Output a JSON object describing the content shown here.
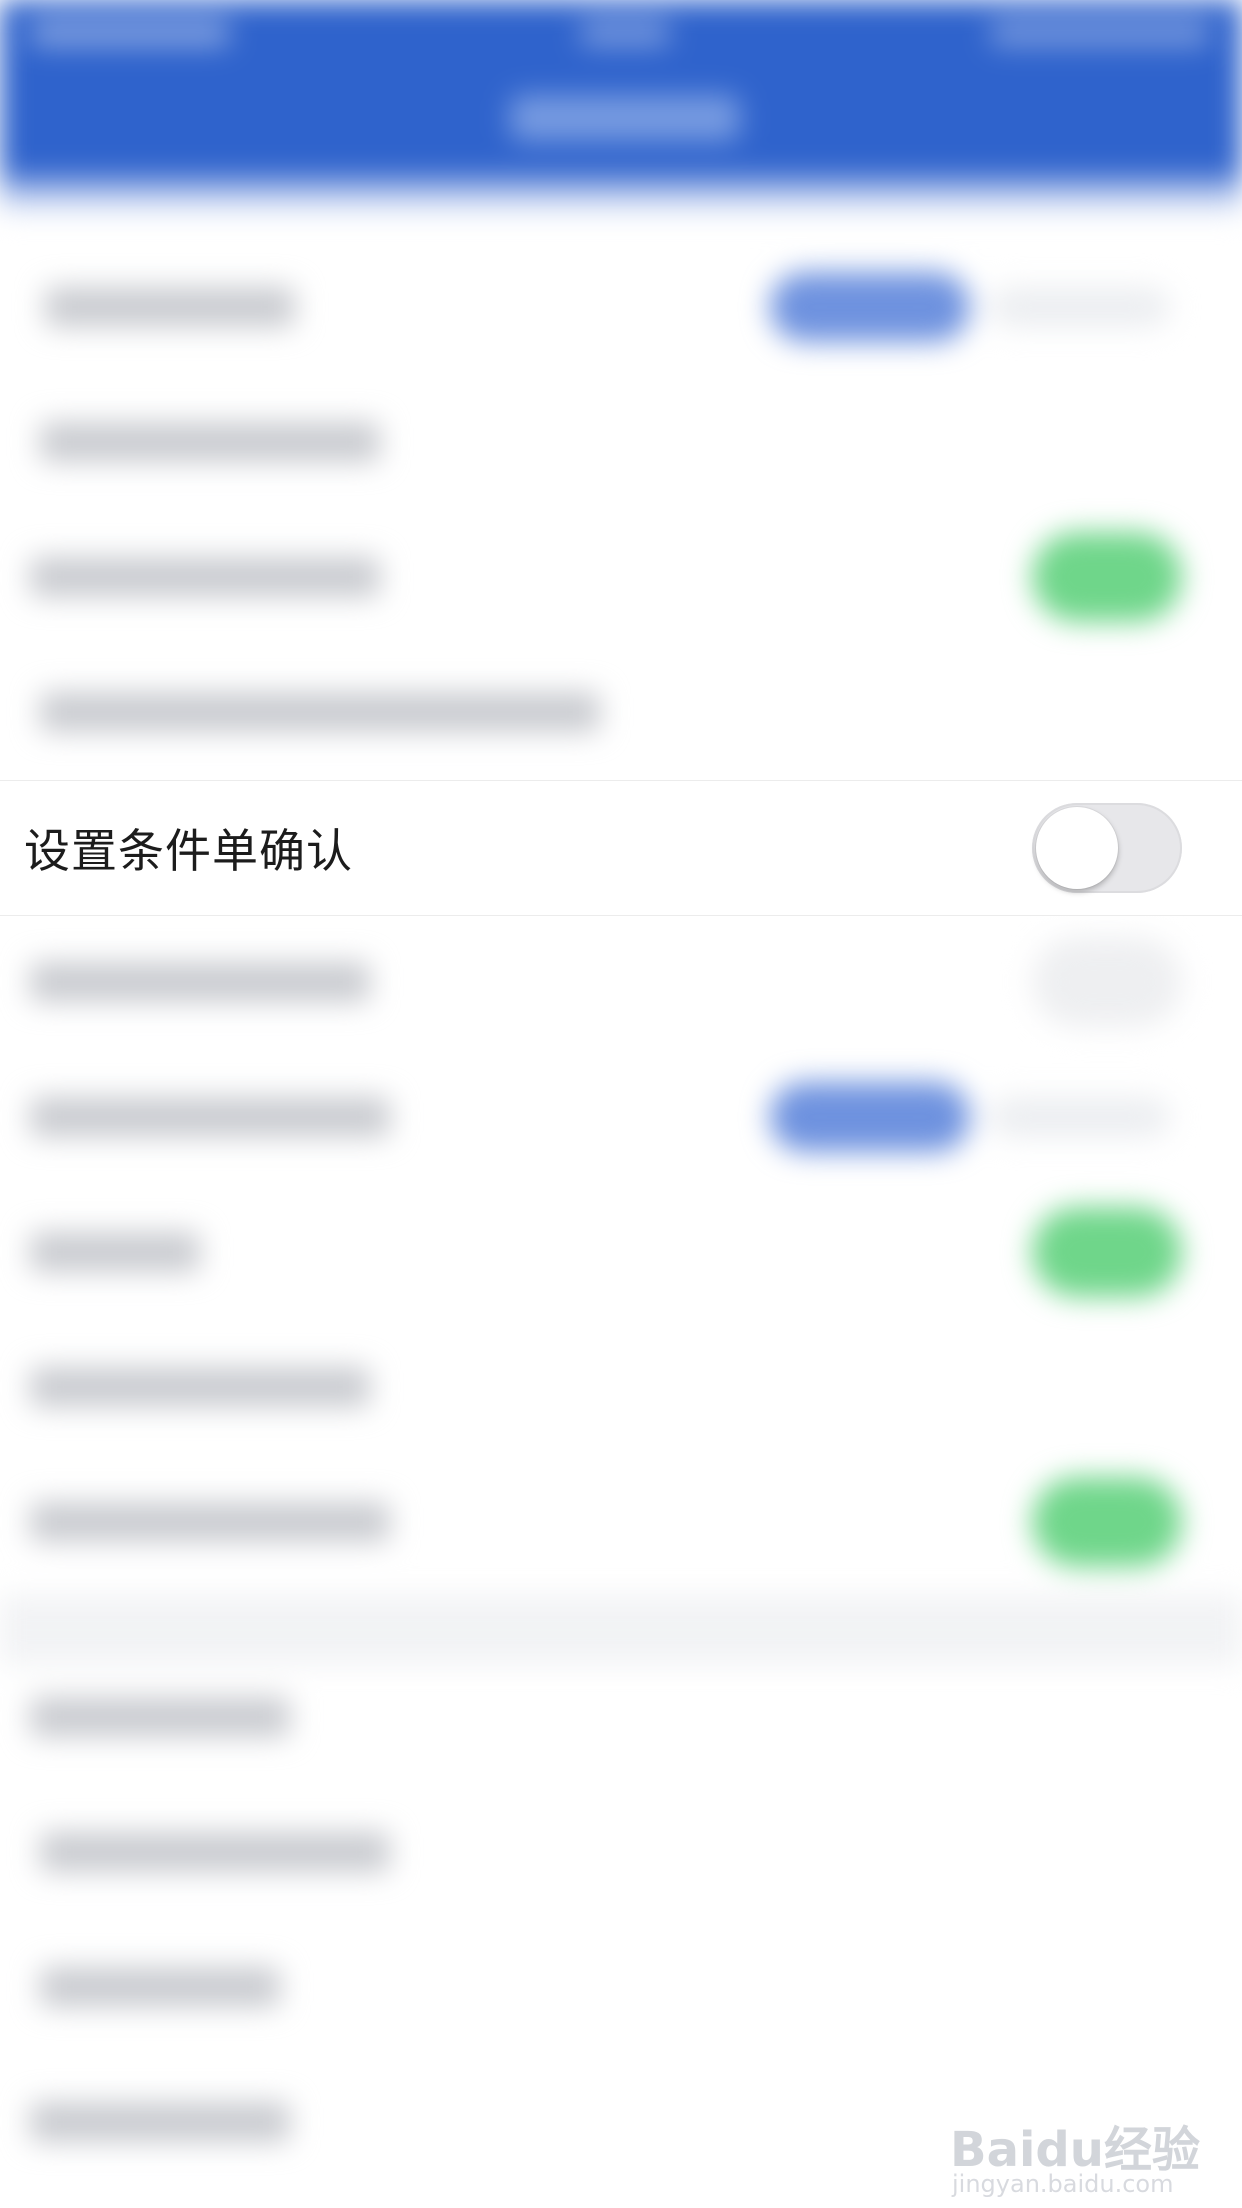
{
  "focused_setting": {
    "label": "设置条件单确认",
    "toggle_on": false
  },
  "colors": {
    "header": "#2f63cc",
    "toggle_on": "#6fd68a",
    "segment": "#6e92df"
  },
  "watermark": {
    "brand": "Baidu经验",
    "url": "jingyan.baidu.com"
  }
}
